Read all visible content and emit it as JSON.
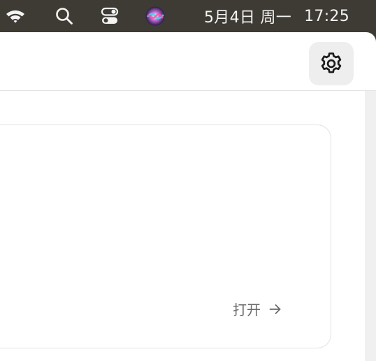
{
  "menubar": {
    "date": "5月4日 周一",
    "time": "17:25",
    "icons": [
      "wifi-icon",
      "search-icon",
      "control-center-icon",
      "siri-icon"
    ]
  },
  "toolbar": {
    "settings_icon": "gear-icon"
  },
  "card": {
    "open_label": "打开",
    "arrow_icon": "arrow-right-icon"
  }
}
